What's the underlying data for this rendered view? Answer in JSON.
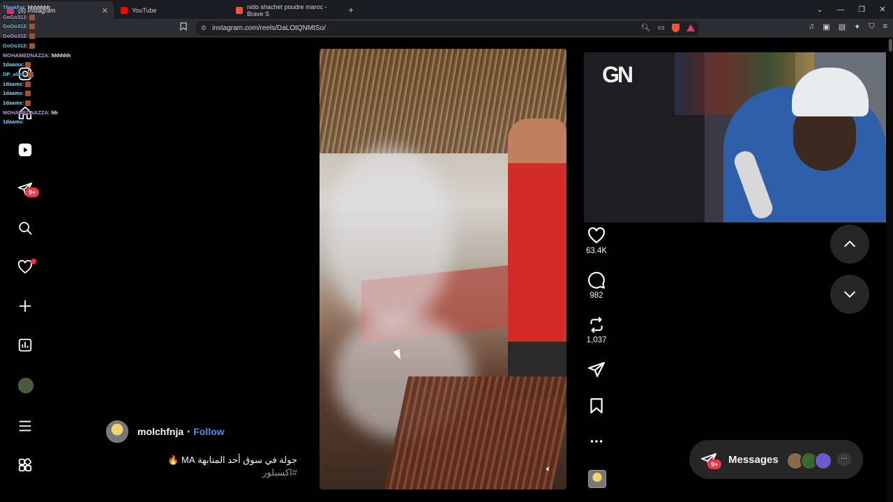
{
  "browser": {
    "tabs": [
      {
        "label": "(8) Instagram",
        "active": true,
        "favicon_color": "#e1306c"
      },
      {
        "label": "YouTube",
        "active": false,
        "favicon_color": "#ff0000"
      },
      {
        "label": "nido shachet poudre maroc - Brave S",
        "active": false,
        "favicon_color": "#fb542b"
      }
    ],
    "new_tab": "+",
    "url": "instagram.com/reels/DaLOtQNMtSo/",
    "window_controls": [
      "⌄",
      "—",
      "❐",
      "✕"
    ]
  },
  "chat": [
    {
      "user": "ThinkFat",
      "text": "hhhhhhh",
      "user_color": "#4fc3f7"
    },
    {
      "user": "GoGo312",
      "text": "",
      "user_color": "#b39ddb",
      "emote": true
    },
    {
      "user": "GoGo312",
      "text": "",
      "user_color": "#4dd0e1",
      "emote": true
    },
    {
      "user": "GoGo312",
      "text": "",
      "user_color": "#b39ddb",
      "emote": true
    },
    {
      "user": "GoGo312",
      "text": "",
      "user_color": "#4dd0e1",
      "emote": true
    },
    {
      "user": "MOHAMEDNAZZA",
      "text": "hhhhhh",
      "user_color": "#b39ddb",
      "emote": false
    },
    {
      "user": "1daamx",
      "text": "",
      "user_color": "#80d8ff",
      "emote": true
    },
    {
      "user": "DP_alien",
      "text": "",
      "user_color": "#4dd0e1",
      "emote": true
    },
    {
      "user": "1daamx",
      "text": "",
      "user_color": "#80d8ff",
      "emote": true
    },
    {
      "user": "1daamx",
      "text": "",
      "user_color": "#80d8ff",
      "emote": true
    },
    {
      "user": "1daamx",
      "text": "",
      "user_color": "#80d8ff",
      "emote": true
    },
    {
      "user": "MOHAMEDNAZZA",
      "text": "hh",
      "user_color": "#b39ddb",
      "emote": false
    },
    {
      "user": "1daamx",
      "text": "",
      "user_color": "#80d8ff",
      "emote": false
    }
  ],
  "sidenav": {
    "items": [
      "instagram-icon",
      "home-icon",
      "reels-icon",
      "messages-icon",
      "search-icon",
      "notifications-icon",
      "create-icon",
      "dashboard-icon",
      "profile-avatar",
      "menu-icon",
      "apps-icon"
    ],
    "messages_badge": "9+"
  },
  "reel": {
    "author": "molchfnja",
    "separator": "•",
    "follow_label": "Follow",
    "caption": "جولة في سوق أحد المنابهة MA 🔥",
    "hashtag": "#اكسبلور",
    "likes": "63.4K",
    "comments": "982",
    "reposts": "1,037"
  },
  "scroll": {
    "up": "up-chevron",
    "down": "down-chevron"
  },
  "messages_pill": {
    "label": "Messages",
    "badge": "9+",
    "more": "···",
    "avatar_colors": [
      "#8a6a4a",
      "#3a6a2a",
      "#6a5acd"
    ]
  },
  "webcam": {
    "logo_text": "GN"
  },
  "colors": {
    "accent": "#4f8cf7",
    "badge": "#ff3040",
    "background": "#000000"
  }
}
